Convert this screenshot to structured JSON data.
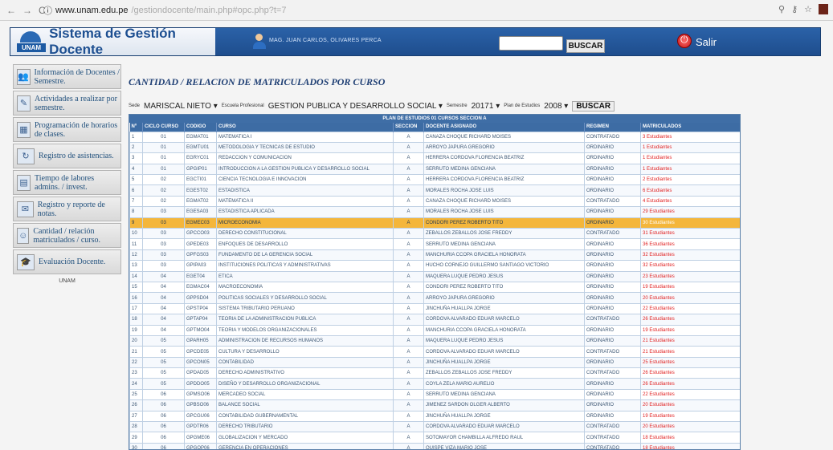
{
  "browser": {
    "url_host": "www.unam.edu.pe",
    "url_path": "/gestiondocente/main.php#opc.php?t=7",
    "back": "←",
    "forward": "→",
    "reload": "C",
    "info": "ⓘ"
  },
  "header": {
    "logo_text": "UNAM",
    "title": "Sistema de Gestión Docente",
    "user": "MAG. JUAN CARLOS, OLIVARES PERCA",
    "search_button": "BUSCAR",
    "logout": "Salir"
  },
  "sidebar": {
    "items": [
      {
        "label": "Información de Docentes / Semestre.",
        "icon": "people-icon"
      },
      {
        "label": "Actividades a realizar por semestre.",
        "icon": "pencil-icon"
      },
      {
        "label": "Programación de horarios de clases.",
        "icon": "calendar-icon"
      },
      {
        "label": "Registro de asistencias.",
        "icon": "refresh-icon"
      },
      {
        "label": "Tiempo de labores admins. / invest.",
        "icon": "chart-icon"
      },
      {
        "label": "Registro y reporte de notas.",
        "icon": "notes-icon"
      },
      {
        "label": "Cantidad / relación matriculados / curso.",
        "icon": "students-icon"
      },
      {
        "label": "Evaluación Docente.",
        "icon": "graduation-icon"
      }
    ],
    "footer": "UNAM"
  },
  "main": {
    "title": "CANTIDAD / RELACION DE MATRICULADOS POR CURSO",
    "filters": {
      "sede_label": "Sede",
      "sede_value": "MARISCAL NIETO",
      "escuela_label": "Escuela Profesional",
      "escuela_value": "GESTION PUBLICA Y DESARROLLO SOCIAL",
      "semestre_label": "Semestre",
      "semestre_value": "20171",
      "plan_label": "Plan de Estudios",
      "plan_value": "2008",
      "button": "BUSCAR"
    },
    "caption": "PLAN DE ESTUDIOS 01 CURSOS SECCION A",
    "columns": [
      "Nº",
      "CICLO CURSO",
      "CODIGO",
      "CURSO",
      "SECCION",
      "DOCENTE ASIGNADO",
      "REGIMEN",
      "MATRICULADOS"
    ],
    "rows": [
      [
        "1",
        "01",
        "EGMAT01",
        "MATEMATICA I",
        "A",
        "CANAZA CHOQUE RICHARD MOISES",
        "CONTRATADO",
        "3 Estudiantes"
      ],
      [
        "2",
        "01",
        "EGMTU01",
        "METODOLOGIA Y TECNICAS DE ESTUDIO",
        "A",
        "ARROYO JAPURA GREGORIO",
        "ORDINARIO",
        "1 Estudiantes"
      ],
      [
        "3",
        "01",
        "EGRYC01",
        "REDACCION Y COMUNICACION",
        "A",
        "HERRERA CORDOVA FLORENCIA BEATRIZ",
        "ORDINARIO",
        "1 Estudiantes"
      ],
      [
        "4",
        "01",
        "GPGIP01",
        "INTRODUCCION A LA GESTION PUBLICA Y DESARROLLO SOCIAL",
        "A",
        "SERRUTO MEDINA GENCIANA",
        "ORDINARIO",
        "1 Estudiantes"
      ],
      [
        "5",
        "02",
        "EGCTI01",
        "CIENCIA TECNOLOGIA E INNOVACION",
        "A",
        "HERRERA CORDOVA FLORENCIA BEATRIZ",
        "ORDINARIO",
        "2 Estudiantes"
      ],
      [
        "6",
        "02",
        "EGEST02",
        "ESTADISTICA",
        "A",
        "MORALES ROCHA JOSE LUIS",
        "ORDINARIO",
        "6 Estudiantes"
      ],
      [
        "7",
        "02",
        "EGMAT02",
        "MATEMATICA II",
        "A",
        "CANAZA CHOQUE RICHARD MOISES",
        "CONTRATADO",
        "4 Estudiantes"
      ],
      [
        "8",
        "03",
        "EGESA03",
        "ESTADISTICA APLICADA",
        "A",
        "MORALES ROCHA JOSE LUIS",
        "ORDINARIO",
        "29 Estudiantes"
      ],
      [
        "9",
        "03",
        "EGMEC03",
        "MICROECONOMIA",
        "A",
        "CONDORI PEREZ ROBERTO TITO",
        "ORDINARIO",
        "30 Estudiantes"
      ],
      [
        "10",
        "03",
        "GPCCO03",
        "DERECHO CONSTITUCIONAL",
        "A",
        "ZEBALLOS ZEBALLOS JOSE FREDDY",
        "CONTRATADO",
        "31 Estudiantes"
      ],
      [
        "11",
        "03",
        "GPEDE03",
        "ENFOQUES DE DESARROLLO",
        "A",
        "SERRUTO MEDINA GENCIANA",
        "ORDINARIO",
        "36 Estudiantes"
      ],
      [
        "12",
        "03",
        "GPFGS03",
        "FUNDAMENTO DE LA GERENCIA SOCIAL",
        "A",
        "MANCHURIA CCOPA GRACIELA HONORATA",
        "ORDINARIO",
        "32 Estudiantes"
      ],
      [
        "13",
        "03",
        "GPIPA03",
        "INSTITUCIONES POLITICAS Y ADMINISTRATIVAS",
        "A",
        "HUCHO CORNEJO GUILLERMO SANTIAGO VICTORIO",
        "ORDINARIO",
        "32 Estudiantes"
      ],
      [
        "14",
        "04",
        "EGET04",
        "ETICA",
        "A",
        "MAQUERA LUQUE PEDRO JESUS",
        "ORDINARIO",
        "23 Estudiantes"
      ],
      [
        "15",
        "04",
        "EGMAC04",
        "MACROECONOMIA",
        "A",
        "CONDORI PEREZ ROBERTO TITO",
        "ORDINARIO",
        "19 Estudiantes"
      ],
      [
        "16",
        "04",
        "GPPSD04",
        "POLITICAS SOCIALES Y DESARROLLO SOCIAL",
        "A",
        "ARROYO JAPURA GREGORIO",
        "ORDINARIO",
        "20 Estudiantes"
      ],
      [
        "17",
        "04",
        "GPSTP04",
        "SISTEMA TRIBUTARIO PERUANO",
        "A",
        "JINCHUÑA HUALLPA JORGE",
        "ORDINARIO",
        "22 Estudiantes"
      ],
      [
        "18",
        "04",
        "GPTAP04",
        "TEORIA DE LA ADMINISTRACION PUBLICA",
        "A",
        "CORDOVA ALVARADO EDUAR MARCELO",
        "CONTRATADO",
        "26 Estudiantes"
      ],
      [
        "19",
        "04",
        "GPTMO04",
        "TEORIA Y MODELOS ORGANIZACIONALES",
        "A",
        "MANCHURIA CCOPA GRACIELA HONORATA",
        "ORDINARIO",
        "19 Estudiantes"
      ],
      [
        "20",
        "05",
        "GPARH05",
        "ADMINISTRACION DE RECURSOS HUMANOS",
        "A",
        "MAQUERA LUQUE PEDRO JESUS",
        "ORDINARIO",
        "21 Estudiantes"
      ],
      [
        "21",
        "05",
        "GPCDE05",
        "CULTURA Y DESARROLLO",
        "A",
        "CORDOVA ALVARADO EDUAR MARCELO",
        "CONTRATADO",
        "21 Estudiantes"
      ],
      [
        "22",
        "05",
        "GPCON05",
        "CONTABILIDAD",
        "A",
        "JINCHUÑA HUALLPA JORGE",
        "ORDINARIO",
        "25 Estudiantes"
      ],
      [
        "23",
        "05",
        "GPDAD05",
        "DERECHO ADMINISTRATIVO",
        "A",
        "ZEBALLOS ZEBALLOS JOSE FREDDY",
        "CONTRATADO",
        "26 Estudiantes"
      ],
      [
        "24",
        "05",
        "GPDDO05",
        "DISEÑO Y DESARROLLO ORGANIZACIONAL",
        "A",
        "COYLA ZELA MARIO AURELIO",
        "ORDINARIO",
        "26 Estudiantes"
      ],
      [
        "25",
        "06",
        "GPMSO06",
        "MERCADEO SOCIAL",
        "A",
        "SERRUTO MEDINA GENCIANA",
        "ORDINARIO",
        "22 Estudiantes"
      ],
      [
        "26",
        "06",
        "GPBSO06",
        "BALANCE SOCIAL",
        "A",
        "JIMENEZ SARDON OLGER ALBERTO",
        "ORDINARIO",
        "20 Estudiantes"
      ],
      [
        "27",
        "06",
        "GPCGU06",
        "CONTABILIDAD GUBERNAMENTAL",
        "A",
        "JINCHUÑA HUALLPA JORGE",
        "ORDINARIO",
        "19 Estudiantes"
      ],
      [
        "28",
        "06",
        "GPDTR06",
        "DERECHO TRIBUTARIO",
        "A",
        "CORDOVA ALVARADO EDUAR MARCELO",
        "CONTRATADO",
        "20 Estudiantes"
      ],
      [
        "29",
        "06",
        "GPGME06",
        "GLOBALIZACION Y MERCADO",
        "A",
        "SOTOMAYOR CHAMBILLA ALFREDO RAUL",
        "CONTRATADO",
        "18 Estudiantes"
      ],
      [
        "30",
        "06",
        "GPGOP06",
        "GERENCIA EN OPERACIONES",
        "A",
        "QUISPE VIZA MARIO JOSE",
        "CONTRATADO",
        "18 Estudiantes"
      ],
      [
        "31",
        "06",
        "GPGPH06",
        "GESTION DEL POTENCIAL HUMANO",
        "A",
        "VERA ALCAZAR MYRIAM MILAGROS",
        "CONTRATADO",
        "17 Estudiantes"
      ]
    ],
    "selected_row_index": 8
  }
}
